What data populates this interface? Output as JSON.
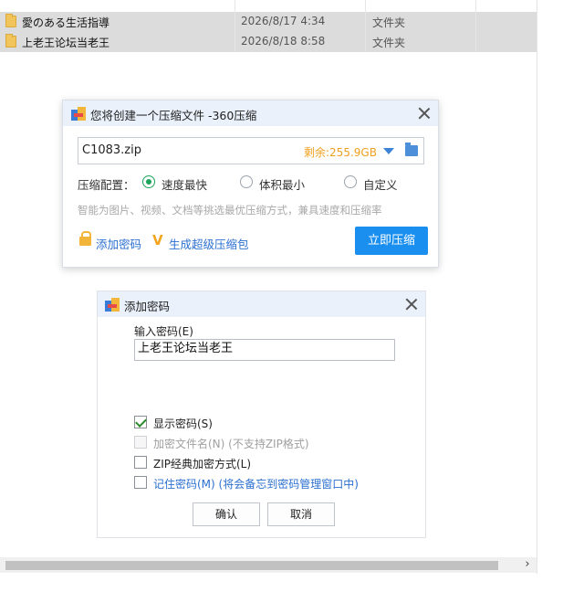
{
  "explorer": {
    "files": [
      {
        "name": "愛のある生活指導",
        "date": "2026/8/17 4:34",
        "type": "文件夹"
      },
      {
        "name": "上老王论坛当老王",
        "date": "2026/8/18 8:58",
        "type": "文件夹"
      }
    ],
    "scroll_right_glyph": "›"
  },
  "compress_dialog": {
    "title": "您将创建一个压缩文件 -360压缩",
    "filename": "C1083.zip",
    "free_space": "剩余:255.9GB",
    "config_label": "压缩配置：",
    "options": [
      {
        "label": "速度最快",
        "selected": true
      },
      {
        "label": "体积最小",
        "selected": false
      },
      {
        "label": "自定义",
        "selected": false
      }
    ],
    "hint": "智能为图片、视频、文档等挑选最优压缩方式，兼具速度和压缩率",
    "add_password_link": "添加密码",
    "super_pack_link": "生成超级压缩包",
    "compress_button": "立即压缩"
  },
  "password_dialog": {
    "title": "添加密码",
    "enter_label": "输入密码(E)",
    "password_value": "上老王论坛当老王",
    "options": [
      {
        "label": "显示密码(S)",
        "checked": true,
        "enabled": true
      },
      {
        "label": "加密文件名(N) (不支持ZIP格式)",
        "checked": false,
        "enabled": false
      },
      {
        "label": "ZIP经典加密方式(L)",
        "checked": false,
        "enabled": true
      },
      {
        "label": "记住密码(M) (将会备忘到密码管理窗口中)",
        "checked": false,
        "enabled": true
      }
    ],
    "ok_button": "确认",
    "cancel_button": "取消"
  },
  "colors": {
    "primary": "#1a8ff0",
    "link": "#2b6fd0",
    "free_space": "#f0a020",
    "radio_selected": "#1aa35a",
    "title_bar": "#eaf1fb"
  }
}
